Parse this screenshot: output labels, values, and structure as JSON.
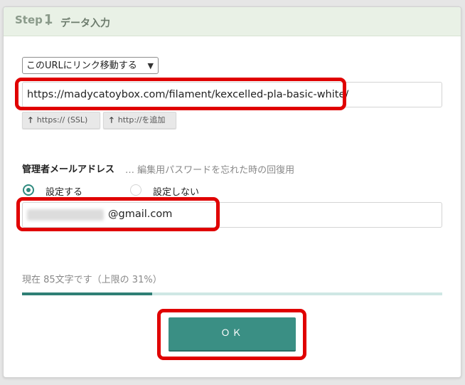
{
  "header": {
    "step_word": "Step",
    "step_number": "1",
    "separator": "：",
    "title": "データ入力"
  },
  "link_mode": {
    "selected": "このURLにリンク移動する",
    "chevron_icon": "chevron-down-icon"
  },
  "url_field": {
    "value": "https://madycatoybox.com/filament/kexcelled-pla-basic-white/"
  },
  "protocol_buttons": [
    {
      "label": "https:// (SSL)",
      "icon": "arrow-up-icon"
    },
    {
      "label": "http://を追加",
      "icon": "arrow-up-icon"
    }
  ],
  "admin_email": {
    "label": "管理者メールアドレス",
    "description": "… 編集用パスワードを忘れた時の回復用",
    "options": [
      {
        "label": "設定する",
        "selected": true
      },
      {
        "label": "設定しない",
        "selected": false
      }
    ],
    "email_domain": "@gmail.com"
  },
  "counter": {
    "text": "現在 85文字です（上限の 31%）",
    "progress_fraction": 0.31
  },
  "ok_button": {
    "label": "ＯＫ"
  },
  "colors": {
    "accent": "#3a8f84",
    "highlight": "#e00000",
    "header_bg": "#e9f1e6",
    "progress_track": "#cfe7e4"
  }
}
